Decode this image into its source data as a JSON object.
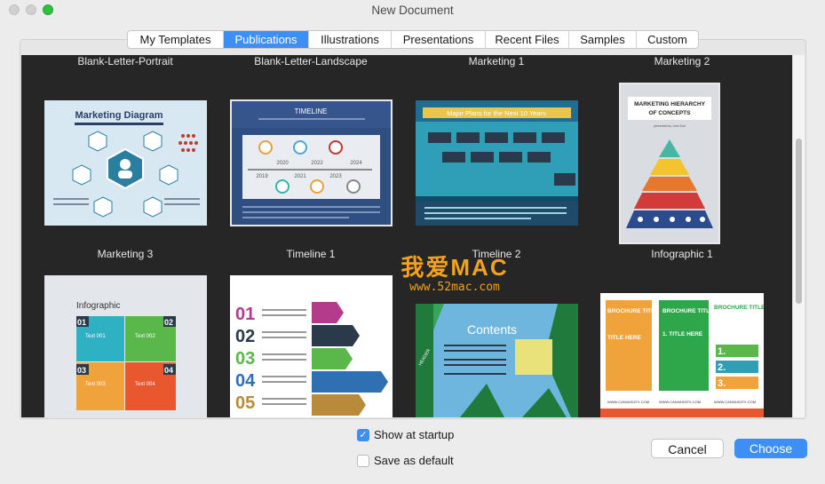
{
  "window": {
    "title": "New Document"
  },
  "tabs": [
    {
      "label": "My Templates"
    },
    {
      "label": "Publications"
    },
    {
      "label": "Illustrations"
    },
    {
      "label": "Presentations"
    },
    {
      "label": "Recent Files"
    },
    {
      "label": "Samples"
    },
    {
      "label": "Custom"
    }
  ],
  "active_tab": "Publications",
  "templates": [
    {
      "label": "Blank-Letter-Portrait",
      "heading": "Marketing Diagram"
    },
    {
      "label": "Blank-Letter-Landscape",
      "heading": "TIMELINE",
      "years": [
        "2019",
        "2020",
        "2021",
        "2022",
        "2023",
        "2024"
      ]
    },
    {
      "label": "Marketing 1",
      "heading": "Major Plans for the Next 10 Years"
    },
    {
      "label": "Marketing 2",
      "heading": "MARKETING HIERARCHY OF CONCEPTS",
      "sub": "presented by John Doe"
    },
    {
      "label": "Marketing 3",
      "heading": "Infographic",
      "items": [
        "Text 001",
        "Text 002",
        "Text 003",
        "Text 004"
      ],
      "numbers": [
        "01",
        "02",
        "03",
        "04"
      ]
    },
    {
      "label": "Timeline 1",
      "numbers": [
        "01",
        "02",
        "03",
        "04",
        "05"
      ]
    },
    {
      "label": "Timeline 2",
      "heading": "Contents",
      "side": "HEADER"
    },
    {
      "label": "Infographic 1",
      "heading": "BROCHURE TITLE",
      "title_here": "TITLE HERE",
      "list_title": "1. TITLE HERE",
      "big": [
        "1.",
        "2.",
        "3."
      ],
      "url": "WWW.CANVASGFX.COM"
    }
  ],
  "watermark": {
    "line1": "我爱MAC",
    "line2": "www.52mac.com"
  },
  "options": {
    "show_at_startup": {
      "label": "Show at startup",
      "checked": true,
      "mark": "✓"
    },
    "save_as_default": {
      "label": "Save as default",
      "checked": false
    }
  },
  "buttons": {
    "cancel": "Cancel",
    "choose": "Choose"
  },
  "colors": {
    "accent": "#3d8ef5",
    "gallery_bg": "#262626"
  }
}
